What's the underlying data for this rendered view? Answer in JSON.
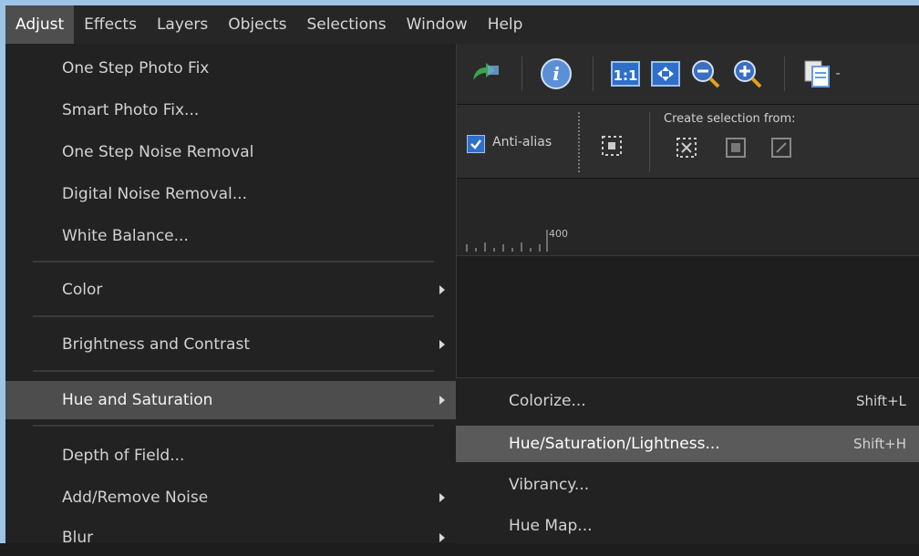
{
  "menubar": {
    "items": [
      {
        "label": "Adjust",
        "active": true
      },
      {
        "label": "Effects"
      },
      {
        "label": "Layers"
      },
      {
        "label": "Objects"
      },
      {
        "label": "Selections"
      },
      {
        "label": "Window"
      },
      {
        "label": "Help"
      }
    ]
  },
  "toolbar": {
    "anti_alias_label": "Anti-alias",
    "create_selection_label": "Create selection from:",
    "ruler_mark": "400"
  },
  "adjust_menu": {
    "items": [
      {
        "label": "One Step Photo Fix"
      },
      {
        "label": "Smart Photo Fix..."
      },
      {
        "label": "One Step Noise Removal"
      },
      {
        "label": "Digital Noise Removal..."
      },
      {
        "label": "White Balance..."
      },
      {
        "label": "Color"
      },
      {
        "label": "Brightness and Contrast"
      },
      {
        "label": "Hue and Saturation"
      },
      {
        "label": "Depth of Field..."
      },
      {
        "label": "Add/Remove Noise"
      },
      {
        "label": "Blur"
      }
    ]
  },
  "hue_submenu": {
    "items": [
      {
        "label": "Colorize...",
        "shortcut": "Shift+L"
      },
      {
        "label": "Hue/Saturation/Lightness...",
        "shortcut": "Shift+H"
      },
      {
        "label": "Vibrancy...",
        "shortcut": ""
      },
      {
        "label": "Hue Map...",
        "shortcut": ""
      }
    ]
  },
  "colors": {
    "frame": "#9dc3e6",
    "menu_bg": "#222222",
    "highlight": "#4d4d4d",
    "submenu_highlight": "#5a5a5a"
  }
}
